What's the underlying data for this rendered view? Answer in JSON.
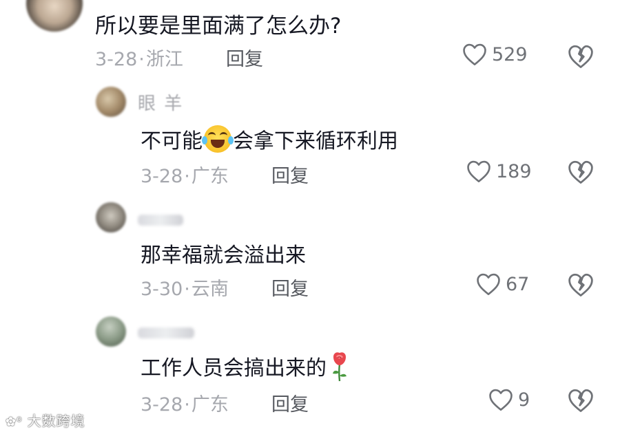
{
  "comments": [
    {
      "text": "所以要是里面满了怎么办?",
      "date": "3-28",
      "location": "浙江",
      "reply_label": "回复",
      "likes": "529"
    }
  ],
  "replies": [
    {
      "username": "眼 羊",
      "text_before": "不可能",
      "emoji": "face-with-tears-of-joy-icon",
      "text_after": "会拿下来循环利用",
      "date": "3-28",
      "location": "广东",
      "reply_label": "回复",
      "likes": "189"
    },
    {
      "username": "",
      "text": "那幸福就会溢出来",
      "date": "3-30",
      "location": "云南",
      "reply_label": "回复",
      "likes": "67"
    },
    {
      "username": "",
      "text": "工作人员会搞出来的",
      "emoji": "rose-icon",
      "date": "3-28",
      "location": "广东",
      "reply_label": "回复",
      "likes": "9"
    }
  ],
  "separator": "·",
  "watermark": "大数跨境",
  "colors": {
    "text": "#161823",
    "meta": "#a6a8ae",
    "icon": "#6f7277"
  }
}
